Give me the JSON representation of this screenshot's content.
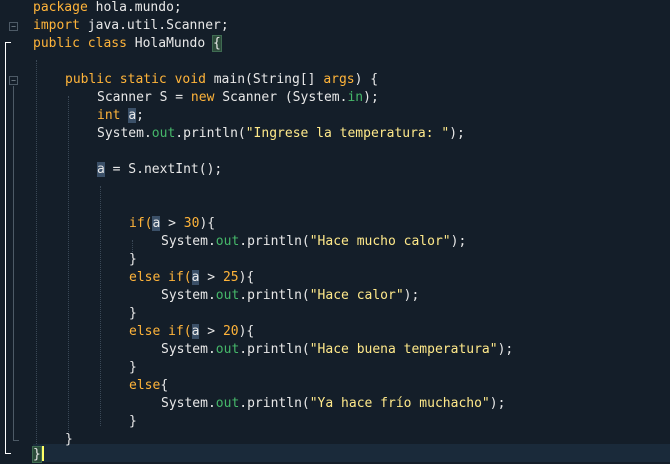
{
  "editor": {
    "language": "Java",
    "package_line": "hola.mundo;",
    "import_line": "java.util.Scanner;",
    "class_name": "HolaMundo",
    "method_signature": {
      "method": "main",
      "param_type": "String[]",
      "param": "args"
    },
    "scanner_decl": "Scanner S = ",
    "scanner_ctor": "Scanner (System.",
    "field_in": "in",
    "int_decl_var": "a",
    "prompt_string": "\"Ingrese la temperatura: \"",
    "read_stmt": " = S.nextInt();",
    "conditions": [
      {
        "keyword": "if(",
        "var": "a",
        "op": " > ",
        "value": "30",
        "message": "\"Hace mucho calor\""
      },
      {
        "keyword": "else if(",
        "var": "a",
        "op": " > ",
        "value": "25",
        "message": "\"Hace calor\""
      },
      {
        "keyword": "else if(",
        "var": "a",
        "op": " > ",
        "value": "20",
        "message": "\"Hace buena temperatura\""
      }
    ],
    "else_message": "\"Ya hace frío muchacho\"",
    "out_field": "out",
    "println": ".println(",
    "system": "System."
  },
  "colors": {
    "background": "#141e29",
    "keyword": "#ffb43a",
    "string": "#ffe98a",
    "field": "#46b86a",
    "text": "#e8e8e8"
  }
}
